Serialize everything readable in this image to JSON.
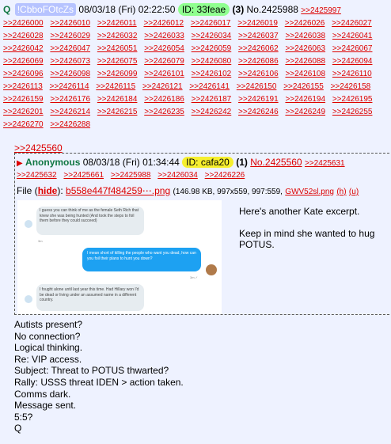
{
  "header": {
    "q": "Q",
    "tripcode": "!CbboFOtcZs",
    "datetime": "08/03/18 (Fri) 02:22:50",
    "id_label": "ID: 33feae",
    "count": "(3)",
    "post_no": "No.2425988",
    "first_reply": ">>2425997"
  },
  "replies": [
    ">>2426000",
    ">>2426010",
    ">>2426011",
    ">>2426012",
    ">>2426017",
    ">>2426019",
    ">>2426026",
    ">>2426027",
    ">>2426028",
    ">>2426029",
    ">>2426032",
    ">>2426033",
    ">>2426034",
    ">>2426037",
    ">>2426038",
    ">>2426041",
    ">>2426042",
    ">>2426047",
    ">>2426051",
    ">>2426054",
    ">>2426059",
    ">>2426062",
    ">>2426063",
    ">>2426067",
    ">>2426069",
    ">>2426073",
    ">>2426075",
    ">>2426079",
    ">>2426080",
    ">>2426086",
    ">>2426088",
    ">>2426094",
    ">>2426096",
    ">>2426098",
    ">>2426099",
    ">>2426101",
    ">>2426102",
    ">>2426106",
    ">>2426108",
    ">>2426110",
    ">>2426113",
    ">>2426114",
    ">>2426115",
    ">>2426121",
    ">>2426141",
    ">>2426150",
    ">>2426155",
    ">>2426158",
    ">>2426159",
    ">>2426176",
    ">>2426184",
    ">>2426186",
    ">>2426187",
    ">>2426191",
    ">>2426194",
    ">>2426195",
    ">>2426201",
    ">>2426214",
    ">>2426215",
    ">>2426235",
    ">>2426242",
    ">>2426246",
    ">>2426249",
    ">>2426255",
    ">>2426270",
    ">>2426288"
  ],
  "quote_link": ">>2425560",
  "inner": {
    "name": "Anonymous",
    "datetime": "08/03/18 (Fri) 01:34:44",
    "id_label": "ID: cafa20",
    "count": "(1)",
    "post_no": "No.2425560",
    "reply_links": [
      ">>2425631",
      ">>2425632",
      ">>2425661",
      ">>2425988",
      ">>2426034",
      ">>2426226"
    ],
    "file_label": "File",
    "hide": "hide",
    "filename": "b558e447f484259⋯.png",
    "file_meta": "(146.98 KB, 997x559, 997:559,",
    "orig_name": "GWV52sl.png",
    "h": "(h)",
    "u": "(u)",
    "text": [
      "Here's another Kate excerpt.",
      "Keep in mind she wanted to hug POTUS."
    ],
    "image": {
      "msg1": "I guess you can think of me as the female Seth Rich that knew she was being hunted (And took the steps to foil them before they could succeed)",
      "msg1_time": "3m",
      "msg2": "I mean short of killing the people who want you dead, how can you foil their plans to hunt you down?",
      "msg2_time": "3m ✓",
      "msg3": "I fought alone until last year this time. Had Hillary won I'd be dead or living under an assumed name in a different country."
    }
  },
  "body_lines": [
    "Autists present?",
    "No connection?",
    "Logical thinking.",
    "Re: VIP access.",
    "Subject: Threat to POTUS thwarted?",
    "Rally: USSS threat IDEN > action taken.",
    "Comms dark.",
    "Message sent.",
    "5:5?",
    "Q"
  ]
}
